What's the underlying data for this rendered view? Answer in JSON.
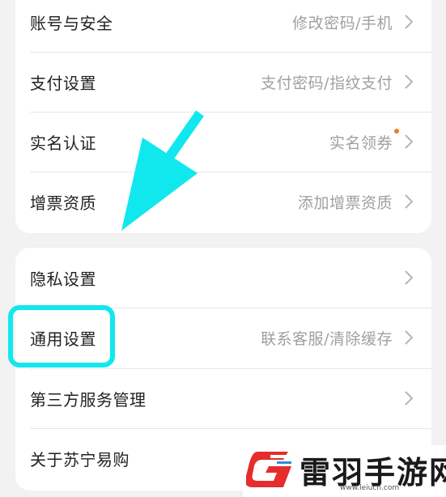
{
  "group1": [
    {
      "label": "账号与安全",
      "value": "修改密码/手机"
    },
    {
      "label": "支付设置",
      "value": "支付密码/指纹支付"
    },
    {
      "label": "实名认证",
      "value": "实名领券"
    },
    {
      "label": "增票资质",
      "value": "添加增票资质"
    }
  ],
  "group2": [
    {
      "label": "隐私设置",
      "value": ""
    },
    {
      "label": "通用设置",
      "value": "联系客服/清除缓存"
    },
    {
      "label": "第三方服务管理",
      "value": ""
    },
    {
      "label": "关于苏宁易购",
      "value": ""
    }
  ],
  "colors": {
    "annotation": "#10e8ee",
    "notification_dot": "#f07a2a",
    "chevron": "#b5b5b5",
    "logo_red": "#e52d2d",
    "logo_blue": "#2a8fd8"
  },
  "watermark": {
    "name": "雷羽手游网",
    "url": "www.leiucn.com"
  }
}
